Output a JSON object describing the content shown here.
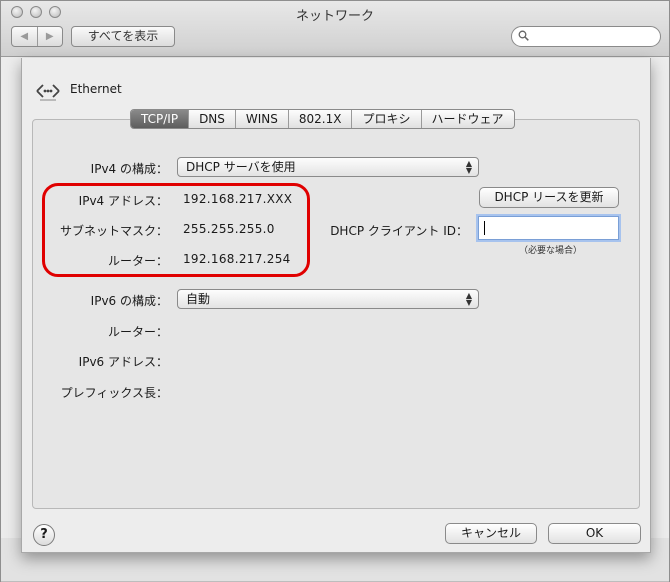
{
  "window": {
    "title": "ネットワーク",
    "nav_back": "◀",
    "nav_forward": "▶",
    "show_all_label": "すべてを表示",
    "search_placeholder": ""
  },
  "sheet": {
    "interface_name": "Ethernet",
    "tabs": [
      {
        "label": "TCP/IP",
        "active": true
      },
      {
        "label": "DNS",
        "active": false
      },
      {
        "label": "WINS",
        "active": false
      },
      {
        "label": "802.1X",
        "active": false
      },
      {
        "label": "プロキシ",
        "active": false
      },
      {
        "label": "ハードウェア",
        "active": false
      }
    ],
    "ipv4": {
      "config_label": "IPv4 の構成：",
      "config_value": "DHCP サーバを使用",
      "address_label": "IPv4 アドレス：",
      "address_value": "192.168.217.XXX",
      "subnet_label": "サブネットマスク：",
      "subnet_value": "255.255.255.0",
      "router_label": "ルーター：",
      "router_value": "192.168.217.254"
    },
    "dhcp": {
      "renew_label": "DHCP リースを更新",
      "client_id_label": "DHCP クライアント ID：",
      "client_id_value": "",
      "hint": "（必要な場合）"
    },
    "ipv6": {
      "config_label": "IPv6 の構成：",
      "config_value": "自動",
      "router_label": "ルーター：",
      "address_label": "IPv6 アドレス：",
      "prefix_label": "プレフィックス長："
    },
    "buttons": {
      "help": "?",
      "cancel": "キャンセル",
      "ok": "OK"
    }
  },
  "colors": {
    "highlight_ring": "#e00000",
    "focus_ring": "#a7c3ee"
  }
}
